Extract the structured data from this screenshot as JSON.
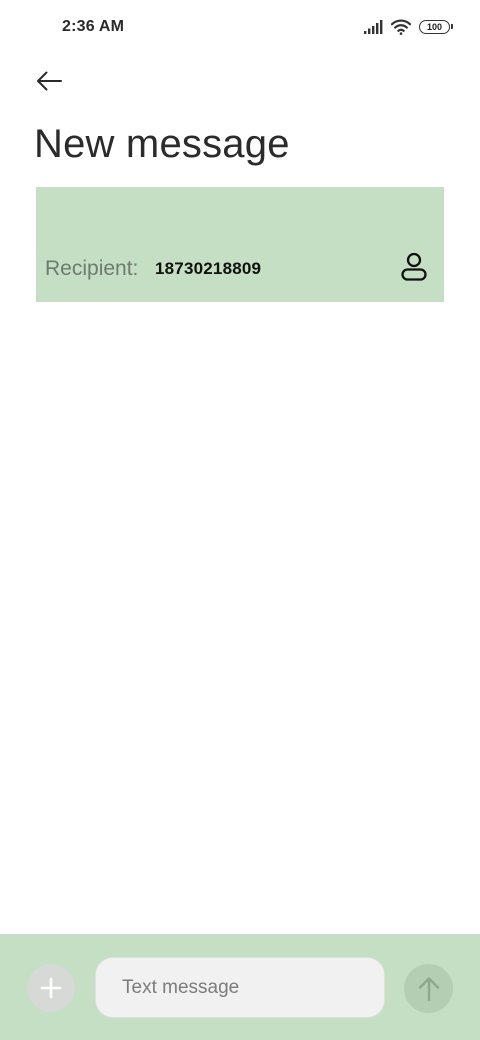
{
  "status_bar": {
    "time": "2:36 AM",
    "battery_level": "100",
    "icons": [
      "signal-icon",
      "wifi-icon",
      "battery-icon"
    ]
  },
  "header": {
    "back_icon": "arrow-left-icon",
    "title": "New message"
  },
  "recipient": {
    "label": "Recipient:",
    "value": "18730218809",
    "contact_icon": "person-icon"
  },
  "composer": {
    "attach_icon": "plus-icon",
    "placeholder": "Text message",
    "value": "",
    "send_icon": "arrow-up-icon"
  },
  "colors": {
    "highlight": "#c4dfc4",
    "input_background": "#f1f1f1",
    "send_button": "#b3ceb3",
    "attach_button": "#d7d9d7"
  }
}
